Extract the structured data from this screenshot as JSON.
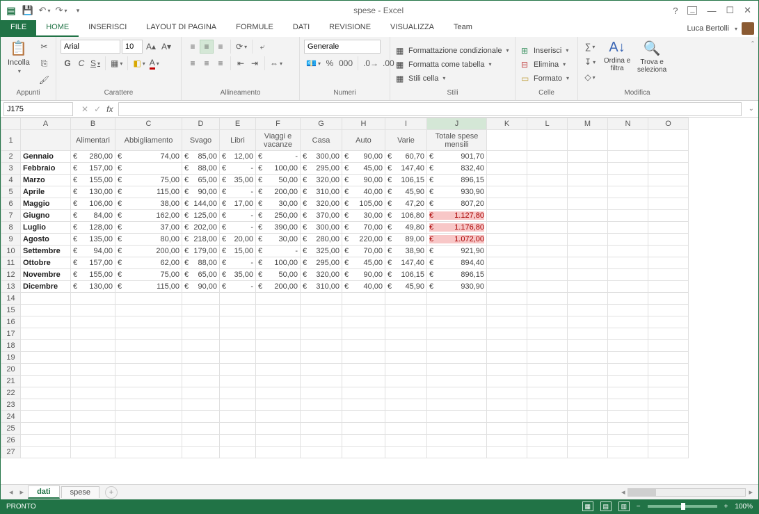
{
  "window": {
    "title": "spese - Excel"
  },
  "user": {
    "name": "Luca Bertolli"
  },
  "tabs": {
    "file": "FILE",
    "home": "HOME",
    "insert": "INSERISCI",
    "layout": "LAYOUT DI PAGINA",
    "formulas": "FORMULE",
    "data": "DATI",
    "review": "REVISIONE",
    "view": "VISUALIZZA",
    "team": "Team"
  },
  "ribbon": {
    "clipboard": {
      "paste": "Incolla",
      "label": "Appunti"
    },
    "font": {
      "name": "Arial",
      "size": "10",
      "label": "Carattere",
      "bold": "G",
      "italic": "C",
      "underline": "S"
    },
    "align": {
      "label": "Allineamento"
    },
    "number": {
      "format": "Generale",
      "label": "Numeri"
    },
    "styles": {
      "cond": "Formattazione condizionale",
      "table": "Formatta come tabella",
      "cell": "Stili cella",
      "label": "Stili"
    },
    "cells": {
      "insert": "Inserisci",
      "delete": "Elimina",
      "format": "Formato",
      "label": "Celle"
    },
    "editing": {
      "sort": "Ordina e filtra",
      "find": "Trova e seleziona",
      "label": "Modifica"
    }
  },
  "namebox": "J175",
  "sheet": {
    "headers": [
      "",
      "Alimentari",
      "Abbigliamento",
      "Svago",
      "Libri",
      "Viaggi e vacanze",
      "Casa",
      "Auto",
      "Varie",
      "Totale spese mensili"
    ],
    "rows": [
      {
        "m": "Gennaio",
        "v": [
          "280,00",
          "74,00",
          "85,00",
          "12,00",
          "-",
          "300,00",
          "90,00",
          "60,70",
          "901,70"
        ]
      },
      {
        "m": "Febbraio",
        "v": [
          "157,00",
          "",
          "88,00",
          "-",
          "100,00",
          "295,00",
          "45,00",
          "147,40",
          "832,40"
        ]
      },
      {
        "m": "Marzo",
        "v": [
          "155,00",
          "75,00",
          "65,00",
          "35,00",
          "50,00",
          "320,00",
          "90,00",
          "106,15",
          "896,15"
        ]
      },
      {
        "m": "Aprile",
        "v": [
          "130,00",
          "115,00",
          "90,00",
          "-",
          "200,00",
          "310,00",
          "40,00",
          "45,90",
          "930,90"
        ]
      },
      {
        "m": "Maggio",
        "v": [
          "106,00",
          "38,00",
          "144,00",
          "17,00",
          "30,00",
          "320,00",
          "105,00",
          "47,20",
          "807,20"
        ]
      },
      {
        "m": "Giugno",
        "v": [
          "84,00",
          "162,00",
          "125,00",
          "-",
          "250,00",
          "370,00",
          "30,00",
          "106,80",
          "1.127,80"
        ],
        "hl": true
      },
      {
        "m": "Luglio",
        "v": [
          "128,00",
          "37,00",
          "202,00",
          "-",
          "390,00",
          "300,00",
          "70,00",
          "49,80",
          "1.176,80"
        ],
        "hl": true
      },
      {
        "m": "Agosto",
        "v": [
          "135,00",
          "80,00",
          "218,00",
          "20,00",
          "30,00",
          "280,00",
          "220,00",
          "89,00",
          "1.072,00"
        ],
        "hl": true
      },
      {
        "m": "Settembre",
        "v": [
          "94,00",
          "200,00",
          "179,00",
          "15,00",
          "-",
          "325,00",
          "70,00",
          "38,90",
          "921,90"
        ]
      },
      {
        "m": "Ottobre",
        "v": [
          "157,00",
          "62,00",
          "88,00",
          "-",
          "100,00",
          "295,00",
          "45,00",
          "147,40",
          "894,40"
        ]
      },
      {
        "m": "Novembre",
        "v": [
          "155,00",
          "75,00",
          "65,00",
          "35,00",
          "50,00",
          "320,00",
          "90,00",
          "106,15",
          "896,15"
        ]
      },
      {
        "m": "Dicembre",
        "v": [
          "130,00",
          "115,00",
          "90,00",
          "-",
          "200,00",
          "310,00",
          "40,00",
          "45,90",
          "930,90"
        ]
      }
    ]
  },
  "sheetTabs": {
    "active": "dati",
    "other": "spese"
  },
  "status": {
    "ready": "PRONTO",
    "zoom": "100%"
  }
}
